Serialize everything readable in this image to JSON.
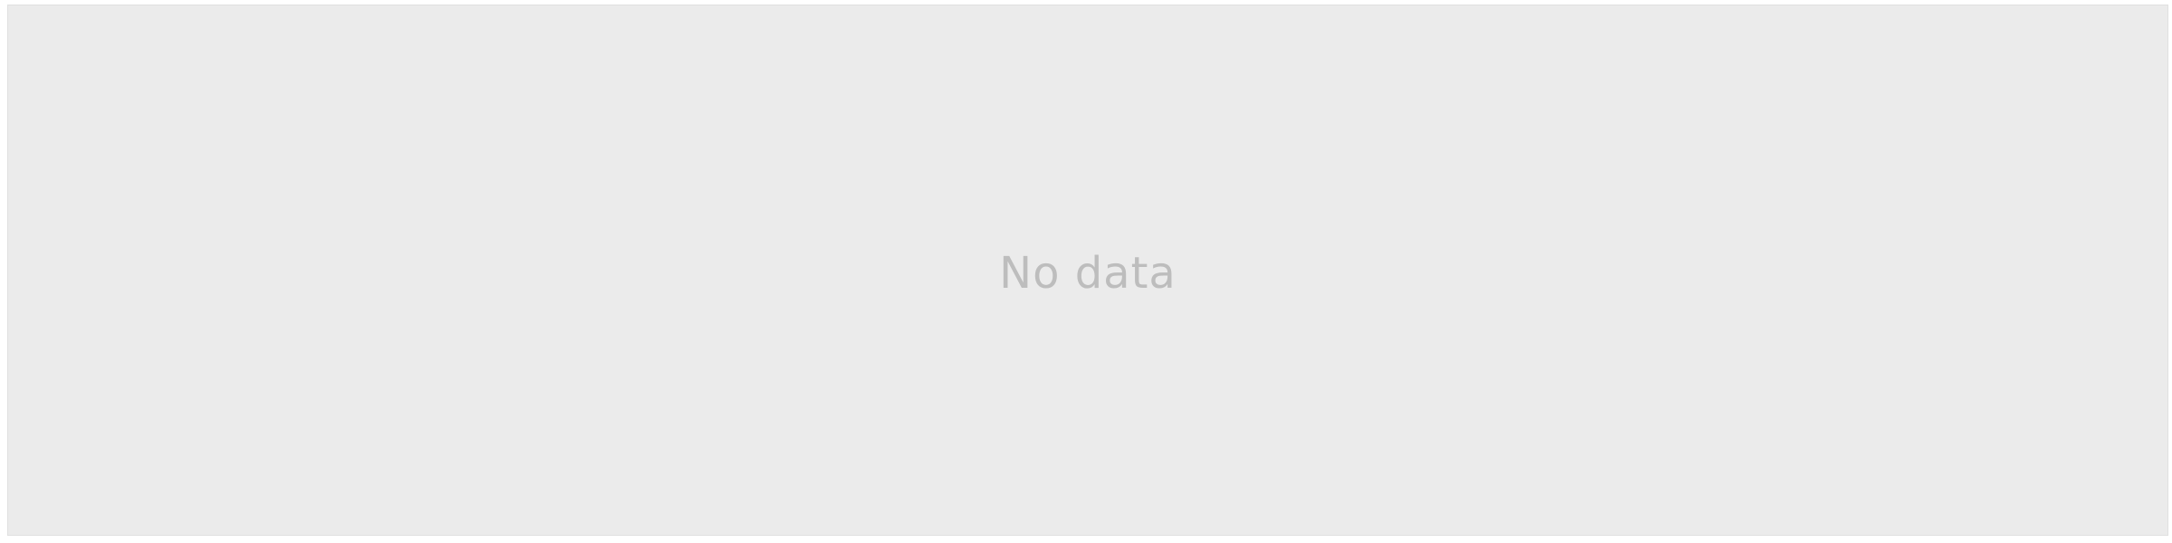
{
  "panel": {
    "empty_message": "No data",
    "background_color": "#ebebeb",
    "text_color": "#bdbdbd"
  }
}
